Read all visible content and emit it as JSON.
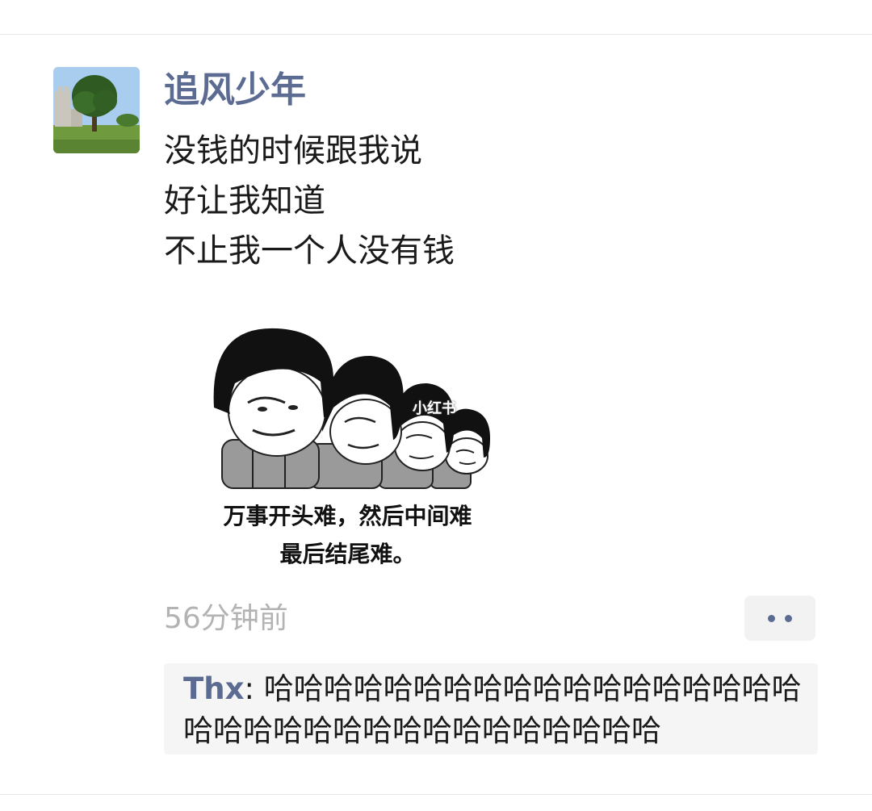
{
  "post": {
    "author": "追风少年",
    "text_lines": [
      "没钱的时候跟我说",
      "好让我知道",
      "不止我一个人没有钱"
    ],
    "timestamp": "56分钟前"
  },
  "meme": {
    "caption_line1": "万事开头难，然后中间难",
    "caption_line2": "最后结尾难。",
    "watermark": "小红书"
  },
  "comment": {
    "author": "Thx",
    "separator": ": ",
    "text": "哈哈哈哈哈哈哈哈哈哈哈哈哈哈哈哈哈哈哈哈哈哈哈哈哈哈哈哈哈哈哈哈哈哈"
  },
  "icons": {
    "more": "more-dots-icon"
  },
  "colors": {
    "name_link": "#5b6b92",
    "timestamp": "#b3b3b3",
    "comment_bg": "#f5f5f5"
  }
}
